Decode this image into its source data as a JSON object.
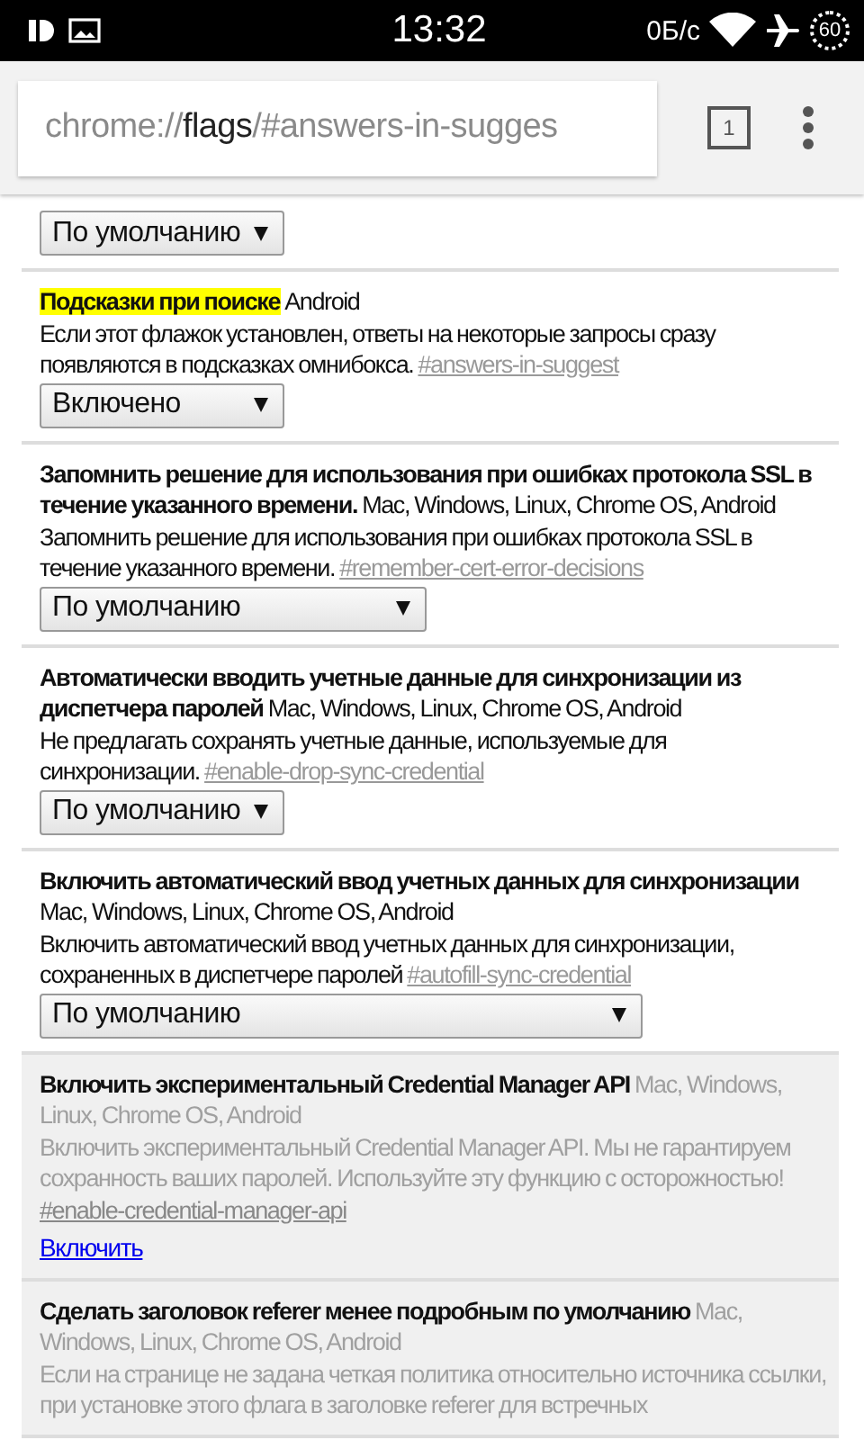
{
  "status_bar": {
    "time": "13:32",
    "speed": "0Б/с",
    "battery": "60"
  },
  "toolbar": {
    "url_scheme": "chrome://",
    "url_host": "flags",
    "url_path": "/#answers-in-sugges",
    "tab_count": "1"
  },
  "top_select": {
    "value": "По умолчанию"
  },
  "flags": [
    {
      "title": "Подсказки при поиске",
      "highlighted": true,
      "disabled": false,
      "platforms": "Android",
      "description": "Если этот флажок установлен, ответы на некоторые запросы сразу появляются в подсказках омнибокса.",
      "anchor": "#answers-in-suggest",
      "control": {
        "kind": "select",
        "value": "Включено"
      }
    },
    {
      "title": "Запомнить решение для использования при ошибках протокола SSL в течение указанного времени.",
      "highlighted": false,
      "disabled": false,
      "platforms": "Mac, Windows, Linux, Chrome OS, Android",
      "description": "Запомнить решение для использования при ошибках протокола SSL в течение указанного времени.",
      "anchor": "#remember-cert-error-decisions",
      "control": {
        "kind": "select",
        "value": "По умолчанию"
      }
    },
    {
      "title": "Автоматически вводить учетные данные для синхронизации из диспетчера паролей",
      "highlighted": false,
      "disabled": false,
      "platforms": "Mac, Windows, Linux, Chrome OS, Android",
      "description": "Не предлагать сохранять учетные данные, используемые для синхронизации.",
      "anchor": "#enable-drop-sync-credential",
      "control": {
        "kind": "select",
        "value": "По умолчанию"
      }
    },
    {
      "title": "Включить автоматический ввод учетных данных для синхронизации",
      "highlighted": false,
      "disabled": false,
      "platforms": "Mac, Windows, Linux, Chrome OS, Android",
      "description": "Включить автоматический ввод учетных данных для синхронизации, сохраненных в диспетчере паролей",
      "anchor": "#autofill-sync-credential",
      "control": {
        "kind": "select",
        "value": "По умолчанию"
      }
    },
    {
      "title": "Включить экспериментальный Credential Manager API",
      "highlighted": false,
      "disabled": true,
      "platforms": "Mac, Windows, Linux, Chrome OS, Android",
      "description": "Включить экспериментальный Credential Manager API. Мы не гарантируем сохранность ваших паролей. Используйте эту функцию с осторожностью!",
      "anchor": "#enable-credential-manager-api",
      "control": {
        "kind": "link",
        "value": "Включить"
      }
    },
    {
      "title": "Сделать заголовок referer менее подробным по умолчанию",
      "highlighted": false,
      "disabled": true,
      "platforms": "Mac, Windows, Linux, Chrome OS, Android",
      "description": "Если на странице не задана четкая политика относительно источника ссылки, при установке этого флага в заголовке referer для встречных"
    }
  ]
}
